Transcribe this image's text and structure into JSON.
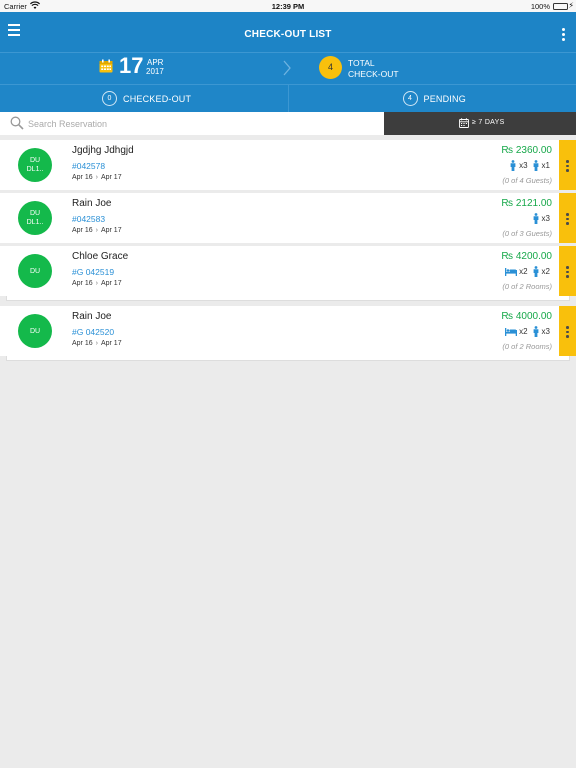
{
  "statusbar": {
    "carrier": "Carrier",
    "time": "12:39 PM",
    "battery": "100%"
  },
  "navbar": {
    "title": "CHECK-OUT LIST"
  },
  "summary": {
    "day": "17",
    "month": "APR",
    "year": "2017",
    "total_count": "4",
    "total_label_line1": "TOTAL",
    "total_label_line2": "CHECK-OUT"
  },
  "tabs": [
    {
      "count": "0",
      "label": "CHECKED-OUT"
    },
    {
      "count": "4",
      "label": "PENDING"
    }
  ],
  "search": {
    "placeholder": "Search Reservation",
    "value": ""
  },
  "filter": {
    "label": "≥ 7 DAYS"
  },
  "colors": {
    "primary": "#1d84c6",
    "accent": "#f9c00c",
    "avatar": "#14b94b",
    "amount": "#17a84a",
    "link": "#2a90d6"
  },
  "reservations": [
    {
      "avatar_line1": "DU",
      "avatar_line2": "DL1..",
      "name": "Jgdjhg Jdhgjd",
      "id": "#042578",
      "from": "Apr 16",
      "to": "Apr 17",
      "amount": "₨ 2360.00",
      "occupancy": [
        {
          "icon": "adult-icon",
          "count": "x3"
        },
        {
          "icon": "child-icon",
          "count": "x1"
        }
      ],
      "note": "(0 of 4 Guests)"
    },
    {
      "avatar_line1": "DU",
      "avatar_line2": "DL1..",
      "name": "Rain Joe",
      "id": "#042583",
      "from": "Apr 16",
      "to": "Apr 17",
      "amount": "₨ 2121.00",
      "occupancy": [
        {
          "icon": "adult-icon",
          "count": "x3"
        }
      ],
      "note": "(0 of 3 Guests)"
    },
    {
      "avatar_line1": "DU",
      "avatar_line2": "",
      "name": "Chloe Grace",
      "id": "#G 042519",
      "from": "Apr 16",
      "to": "Apr 17",
      "amount": "₨ 4200.00",
      "occupancy": [
        {
          "icon": "bed-icon",
          "count": "x2"
        },
        {
          "icon": "adult-icon",
          "count": "x2"
        }
      ],
      "note": "(0 of 2 Rooms)"
    },
    {
      "avatar_line1": "DU",
      "avatar_line2": "",
      "name": "Rain Joe",
      "id": "#G 042520",
      "from": "Apr 16",
      "to": "Apr 17",
      "amount": "₨ 4000.00",
      "occupancy": [
        {
          "icon": "bed-icon",
          "count": "x2"
        },
        {
          "icon": "adult-icon",
          "count": "x3"
        }
      ],
      "note": "(0 of 2 Rooms)"
    }
  ]
}
